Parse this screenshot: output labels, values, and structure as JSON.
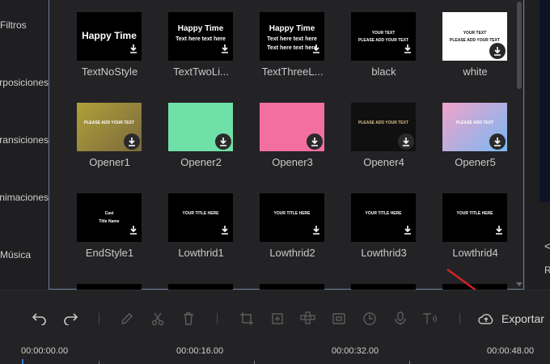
{
  "sidebar": {
    "items": [
      {
        "label": "Filtros"
      },
      {
        "label": "Superposiciones"
      },
      {
        "label": "Transiciones"
      },
      {
        "label": "Animaciones"
      },
      {
        "label": "Música"
      }
    ]
  },
  "templates": [
    {
      "name": "TextNoStyle",
      "l1": "Happy Time",
      "l2": "",
      "l3": ""
    },
    {
      "name": "TextTwoLi...",
      "l1": "Happy Time",
      "l2": "Text here text here",
      "l3": ""
    },
    {
      "name": "TextThreeL...",
      "l1": "Happy Time",
      "l2": "Text here text here",
      "l3": "Text here text here"
    },
    {
      "name": "black",
      "l1": "YOUR TEXT",
      "l2": "PLEASE ADD YOUR TEXT",
      "l3": ""
    },
    {
      "name": "white",
      "l1": "YOUR TEXT",
      "l2": "PLEASE ADD YOUR TEXT",
      "l3": ""
    },
    {
      "name": "Opener1",
      "l1": "PLEASE ADD YOUR TEXT",
      "l2": "",
      "l3": ""
    },
    {
      "name": "Opener2",
      "l1": "",
      "l2": "",
      "l3": ""
    },
    {
      "name": "Opener3",
      "l1": "",
      "l2": "",
      "l3": ""
    },
    {
      "name": "Opener4",
      "l1": "PLEASE ADD YOUR TEXT",
      "l2": "",
      "l3": ""
    },
    {
      "name": "Opener5",
      "l1": "PLEASE ADD TEXT",
      "l2": "",
      "l3": ""
    },
    {
      "name": "EndStyle1",
      "l1": "Cast",
      "l2": "Title Name",
      "l3": ""
    },
    {
      "name": "Lowthrid1",
      "l1": "YOUR TITLE HERE",
      "l2": "",
      "l3": ""
    },
    {
      "name": "Lowthrid2",
      "l1": "YOUR TITLE HERE",
      "l2": "",
      "l3": ""
    },
    {
      "name": "Lowthrid3",
      "l1": "YOUR TITLE HERE",
      "l2": "",
      "l3": ""
    },
    {
      "name": "Lowthrid4",
      "l1": "YOUR TITLE HERE",
      "l2": "",
      "l3": ""
    }
  ],
  "toolbar": {
    "export_label": "Exportar",
    "icons": [
      "undo-icon",
      "redo-icon",
      "pen-icon",
      "scissors-icon",
      "trash-icon",
      "crop-icon",
      "fit-icon",
      "mosaic-icon",
      "screenshot-icon",
      "speed-icon",
      "mic-icon",
      "text-speech-icon",
      "export-icon"
    ]
  },
  "timeline": {
    "timecodes": [
      "00:00:00.00",
      "00:00:16.00",
      "00:00:32.00",
      "00:00:48.00"
    ]
  },
  "right_panel": {
    "letter": "R"
  },
  "colors": {
    "accent": "#d32323",
    "frame": "#6d7f99"
  }
}
